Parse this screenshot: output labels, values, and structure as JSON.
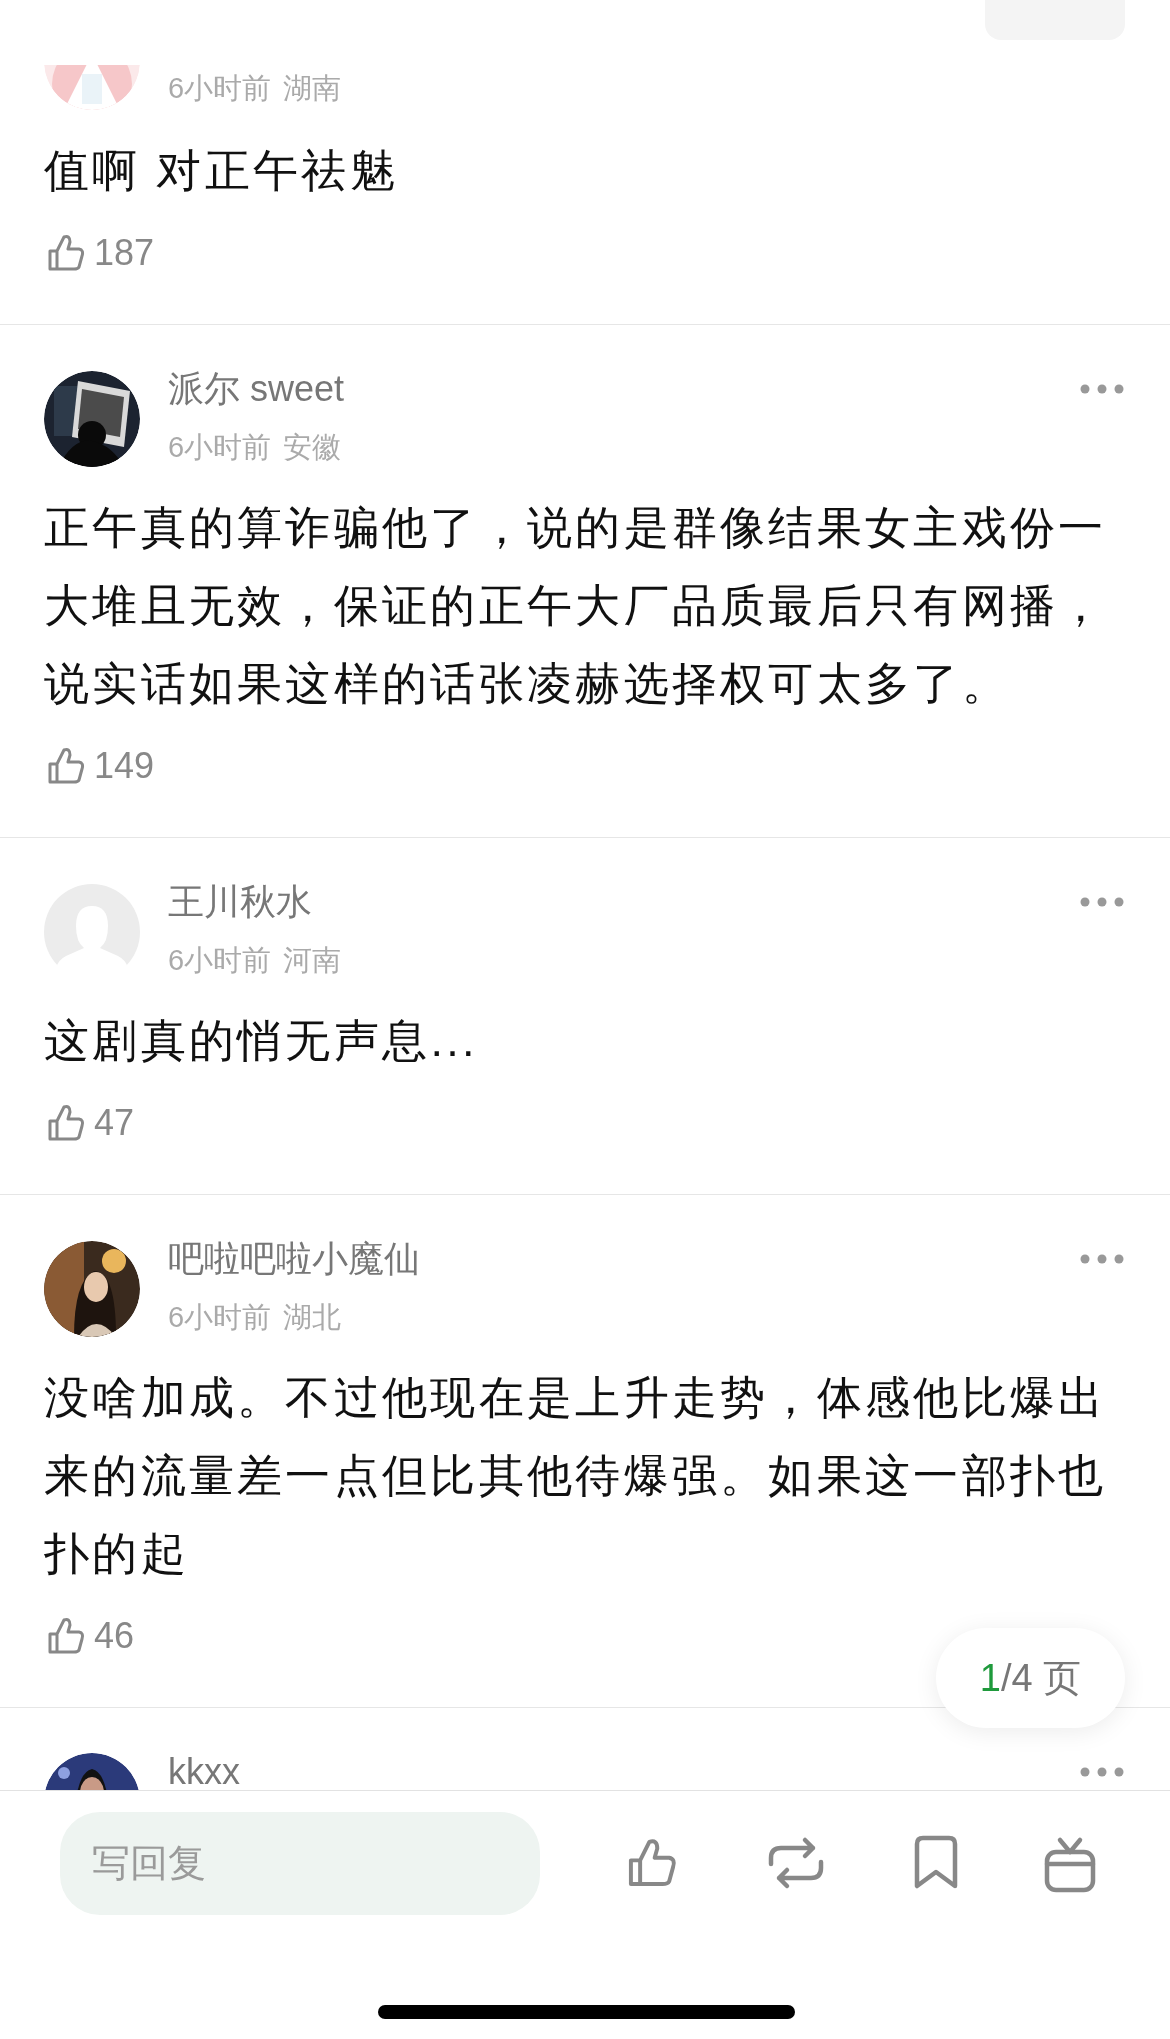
{
  "comments": [
    {
      "time": "6小时前",
      "location": "湖南",
      "text": "值啊 对正午祛魅",
      "likes": "187"
    },
    {
      "name": "派尔 sweet",
      "time": "6小时前",
      "location": "安徽",
      "text": "正午真的算诈骗他了，说的是群像结果女主戏份一大堆且无效，保证的正午大厂品质最后只有网播，说实话如果这样的话张凌赫选择权可太多了。",
      "likes": "149"
    },
    {
      "avatar": {
        "kind": "default"
      },
      "name": "王川秋水",
      "time": "6小时前",
      "location": "河南",
      "text": "这剧真的悄无声息...",
      "likes": "47"
    },
    {
      "name": "吧啦吧啦小魔仙",
      "time": "6小时前",
      "location": "湖北",
      "text": "没啥加成。不过他现在是上升走势，体感他比爆出来的流量差一点但比其他待爆强。如果这一部扑也扑的起",
      "likes": "46"
    },
    {
      "name": "kkxx"
    }
  ],
  "pager": {
    "current": "1",
    "rest": "/4 页"
  },
  "bottom_bar": {
    "reply": {
      "placeholder": "写回复"
    }
  }
}
